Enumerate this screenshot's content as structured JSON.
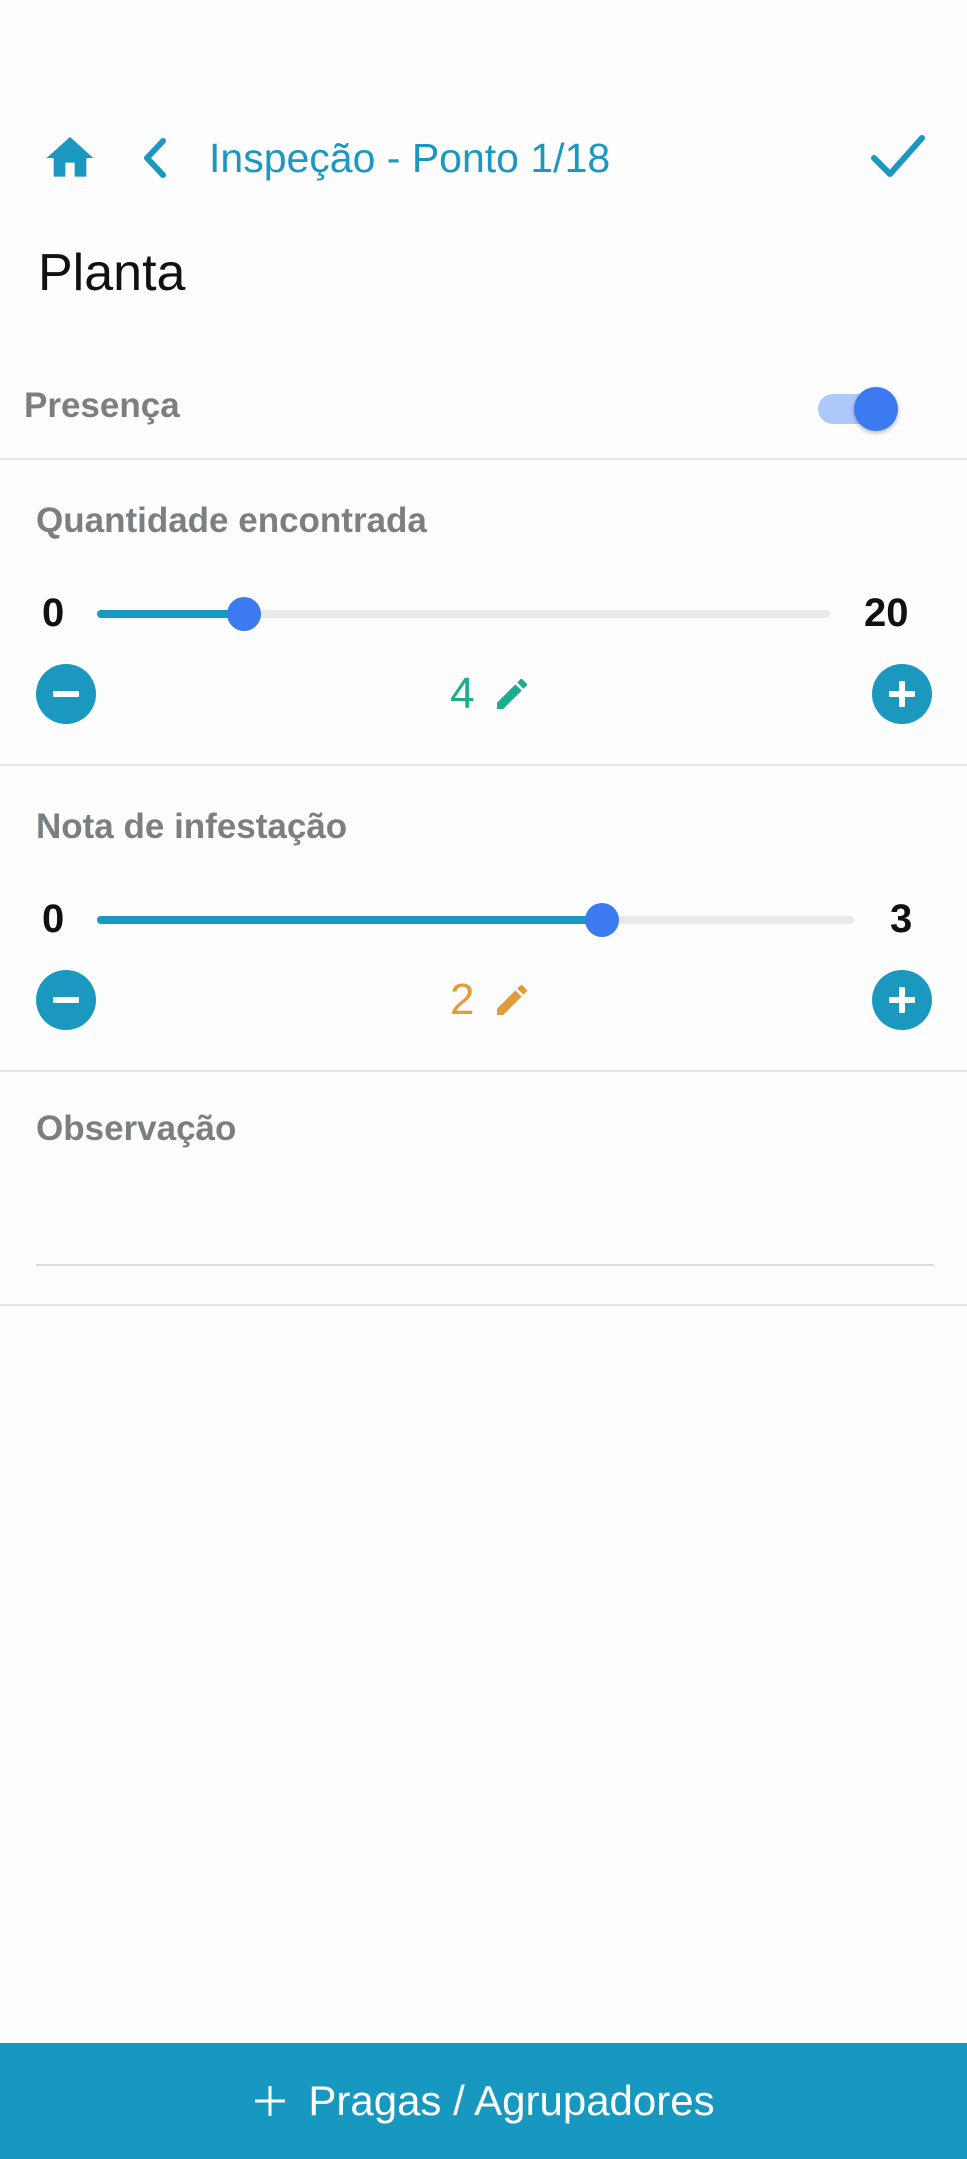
{
  "header": {
    "title": "Inspeção - Ponto 1/18",
    "home_icon": "home-icon",
    "back_icon": "chevron-left-icon",
    "confirm_icon": "check-icon",
    "accent_color": "#1a98bf"
  },
  "plant": {
    "title": "Planta"
  },
  "presence": {
    "label": "Presença",
    "enabled": true
  },
  "quantity": {
    "label": "Quantidade encontrada",
    "min": "0",
    "max": "20",
    "value": "4",
    "value_fraction": 0.2,
    "value_color": "#1cae8c"
  },
  "infestation": {
    "label": "Nota de infestação",
    "min": "0",
    "max": "3",
    "value": "2",
    "value_fraction": 0.667,
    "value_color": "#e39a3b"
  },
  "observation": {
    "label": "Observação",
    "value": ""
  },
  "bottom_bar": {
    "label": "Pragas / Agrupadores",
    "color": "#1798c1"
  }
}
